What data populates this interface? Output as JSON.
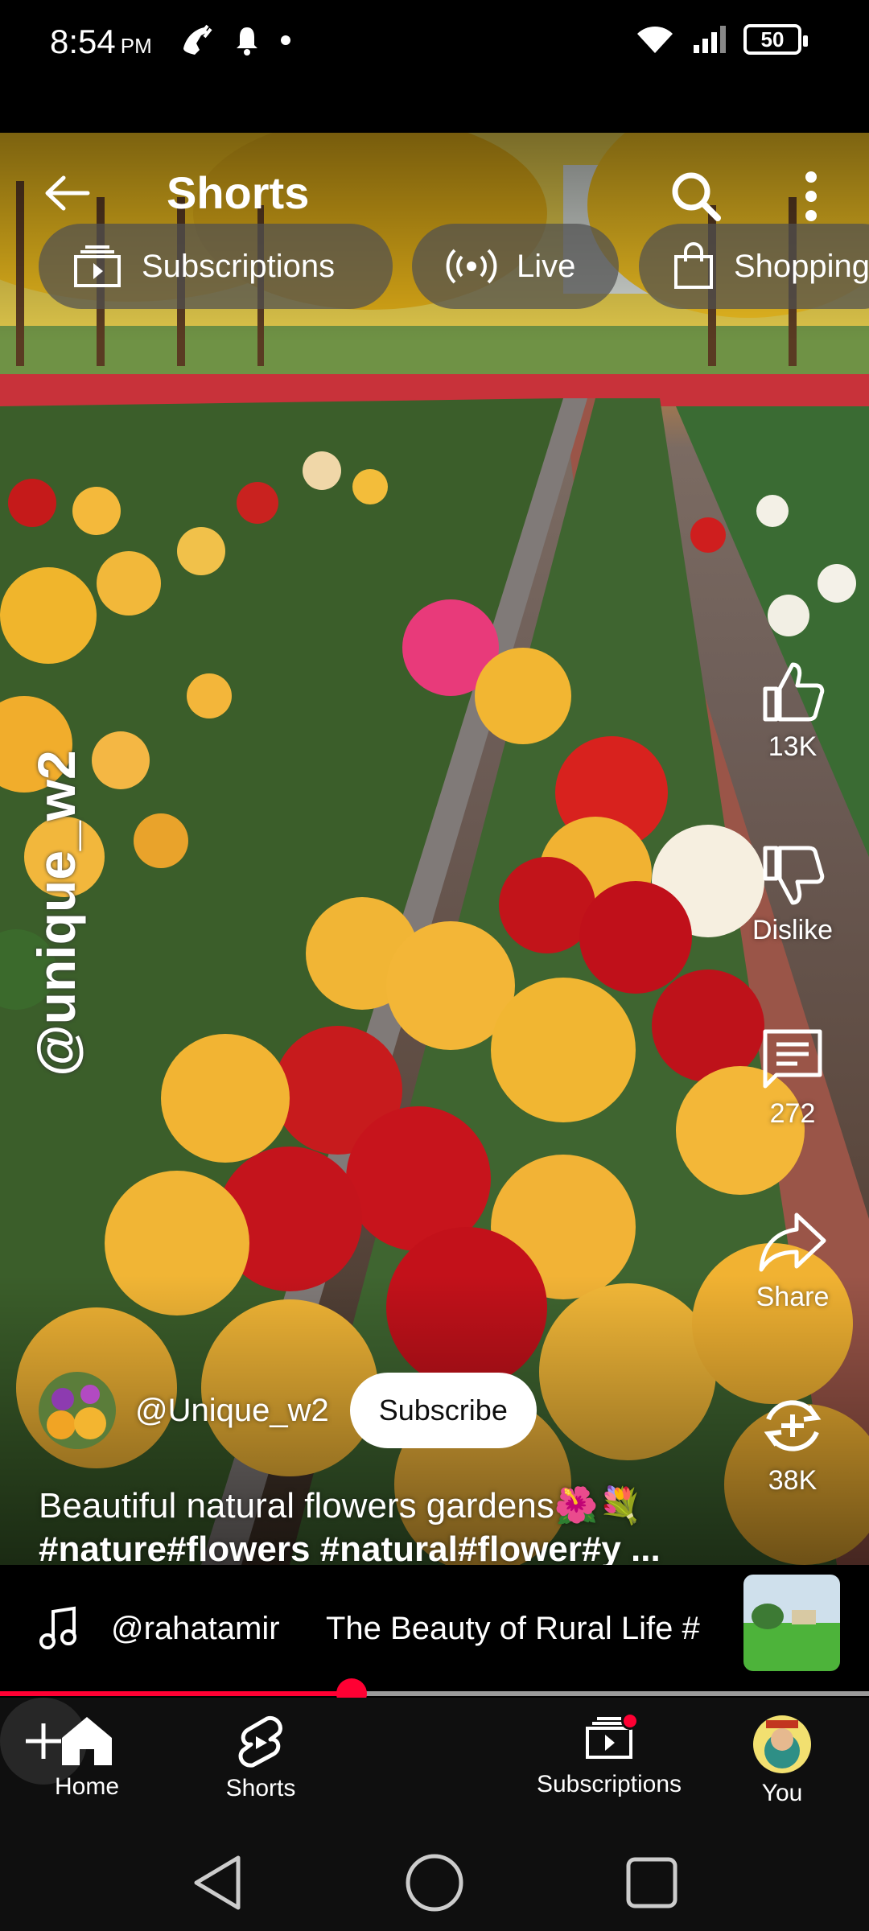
{
  "status_bar": {
    "time": "8:54",
    "ampm": "PM",
    "battery": "50"
  },
  "header": {
    "title": "Shorts"
  },
  "chips": [
    {
      "label": "Subscriptions",
      "icon": "subscriptions-icon"
    },
    {
      "label": "Live",
      "icon": "live-icon"
    },
    {
      "label": "Shopping",
      "icon": "shopping-bag-icon"
    }
  ],
  "video": {
    "watermark": "@unique_w2"
  },
  "actions": {
    "like_count": "13K",
    "dislike_label": "Dislike",
    "comment_count": "272",
    "share_label": "Share",
    "remix_count": "38K"
  },
  "channel": {
    "name": "@Unique_w2",
    "subscribe_label": "Subscribe"
  },
  "caption": {
    "text": "Beautiful natural flowers gardens🌺💐",
    "hashtags": "#nature#flowers #natural#flower#y ..."
  },
  "sound": {
    "user": "@rahatamir",
    "title": "The Beauty of Rural Life #"
  },
  "progress": {
    "fraction": 0.405
  },
  "bottom_nav": {
    "home": "Home",
    "shorts": "Shorts",
    "subscriptions": "Subscriptions",
    "you": "You"
  },
  "colors": {
    "accent": "#ff0033",
    "nav_bg": "#0f0f0f"
  }
}
